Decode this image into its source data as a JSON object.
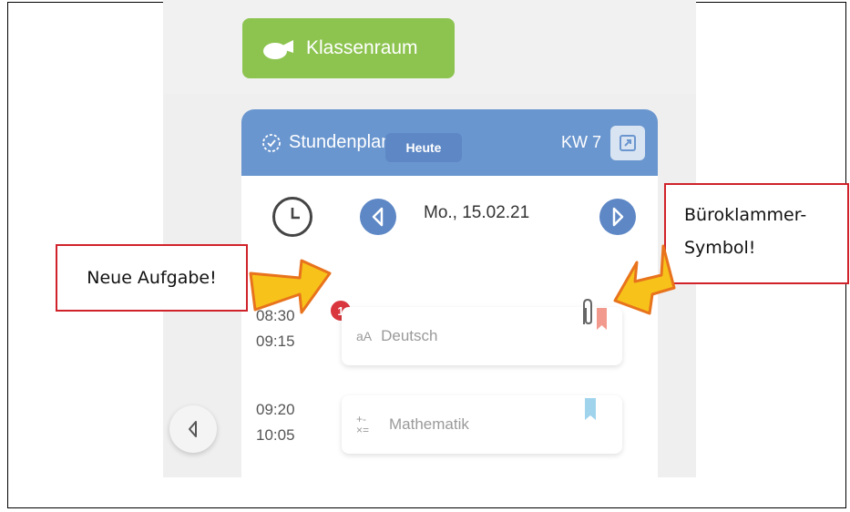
{
  "app": {
    "classroom_button": "Klassenraum",
    "schedule_title": "Stundenplan",
    "week_label": "KW 7",
    "date": "Mo., 15.02.21",
    "today_button": "Heute"
  },
  "lessons": [
    {
      "start": "08:30",
      "end": "09:15",
      "subject": "Deutsch",
      "subject_icon": "aA",
      "badge": "1"
    },
    {
      "start": "09:20",
      "end": "10:05",
      "subject": "Mathematik",
      "subject_icon": "+-×="
    }
  ],
  "annotations": {
    "new_task": "Neue Aufgabe!",
    "paperclip_line1": "Büroklammer-",
    "paperclip_line2": "Symbol!"
  },
  "colors": {
    "green": "#8dc450",
    "blue": "#6a96cf",
    "badge_red": "#d9363e",
    "callout_border": "#d0222a",
    "arrow_fill": "#f7c31a",
    "arrow_stroke": "#e8731c"
  }
}
